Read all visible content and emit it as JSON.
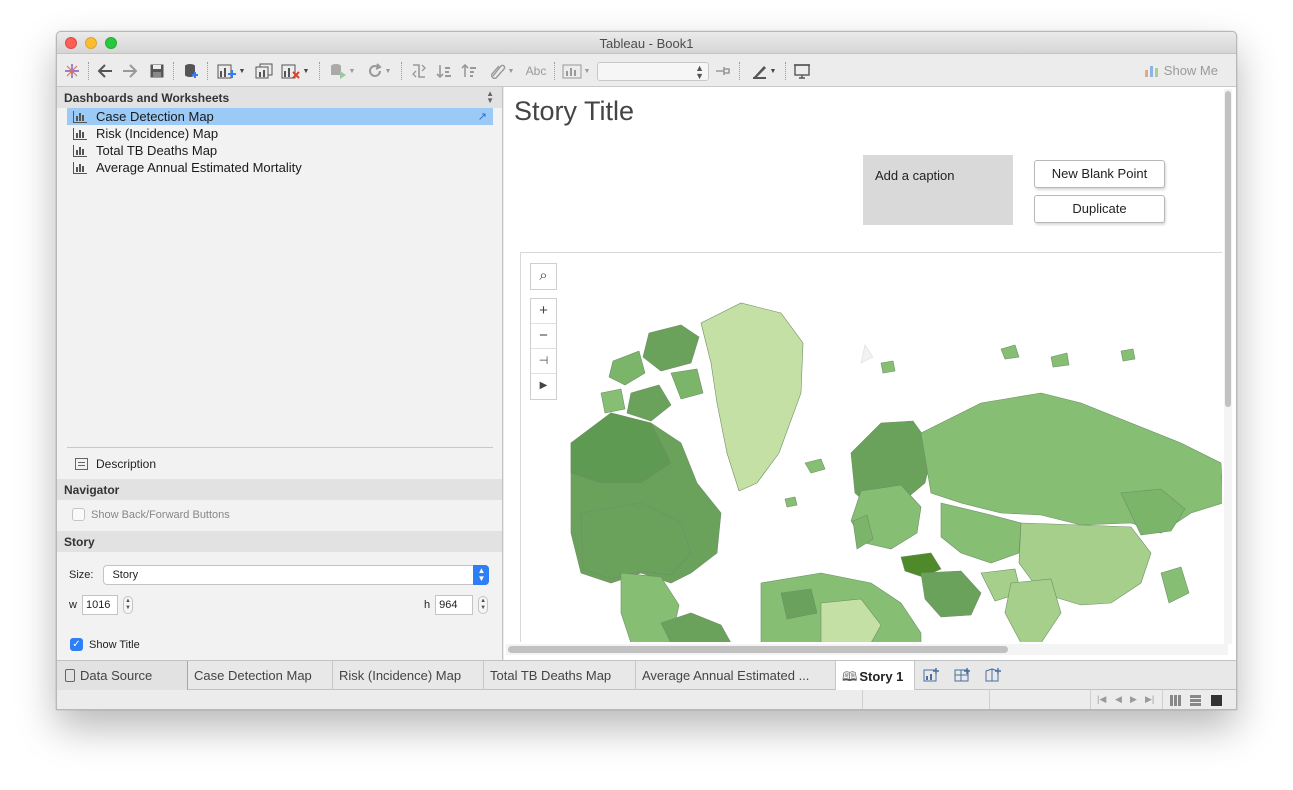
{
  "window": {
    "title": "Tableau - Book1"
  },
  "toolbar": {
    "show_me": "Show Me",
    "abc": "Abc"
  },
  "left_pane": {
    "dashboards_header": "Dashboards and Worksheets",
    "sheets": [
      {
        "label": "Case Detection Map",
        "selected": true
      },
      {
        "label": "Risk (Incidence) Map",
        "selected": false
      },
      {
        "label": "Total TB Deaths Map",
        "selected": false
      },
      {
        "label": "Average Annual Estimated Mortality",
        "selected": false
      }
    ],
    "description_label": "Description",
    "navigator_header": "Navigator",
    "show_back_forward": "Show Back/Forward Buttons",
    "story_header": "Story",
    "size_label": "Size:",
    "size_value": "Story",
    "w_label": "w",
    "w_value": "1016",
    "h_label": "h",
    "h_value": "964",
    "show_title_label": "Show Title",
    "show_title_checked": true
  },
  "story": {
    "title": "Story Title",
    "caption_placeholder": "Add a caption",
    "new_blank_point": "New Blank Point",
    "duplicate": "Duplicate"
  },
  "tabs": {
    "data_source": "Data Source",
    "sheets": [
      "Case Detection Map",
      "Risk (Incidence) Map",
      "Total TB Deaths Map",
      "Average Annual Estimated ..."
    ],
    "active": "Story 1"
  },
  "colors": {
    "selection": "#9ccaf7",
    "accent_blue": "#2e7ef6",
    "map_dark": "#5e9a52",
    "map_mid": "#86be74",
    "map_light": "#c4e0a4",
    "map_highlight": "#4e8a2a"
  }
}
